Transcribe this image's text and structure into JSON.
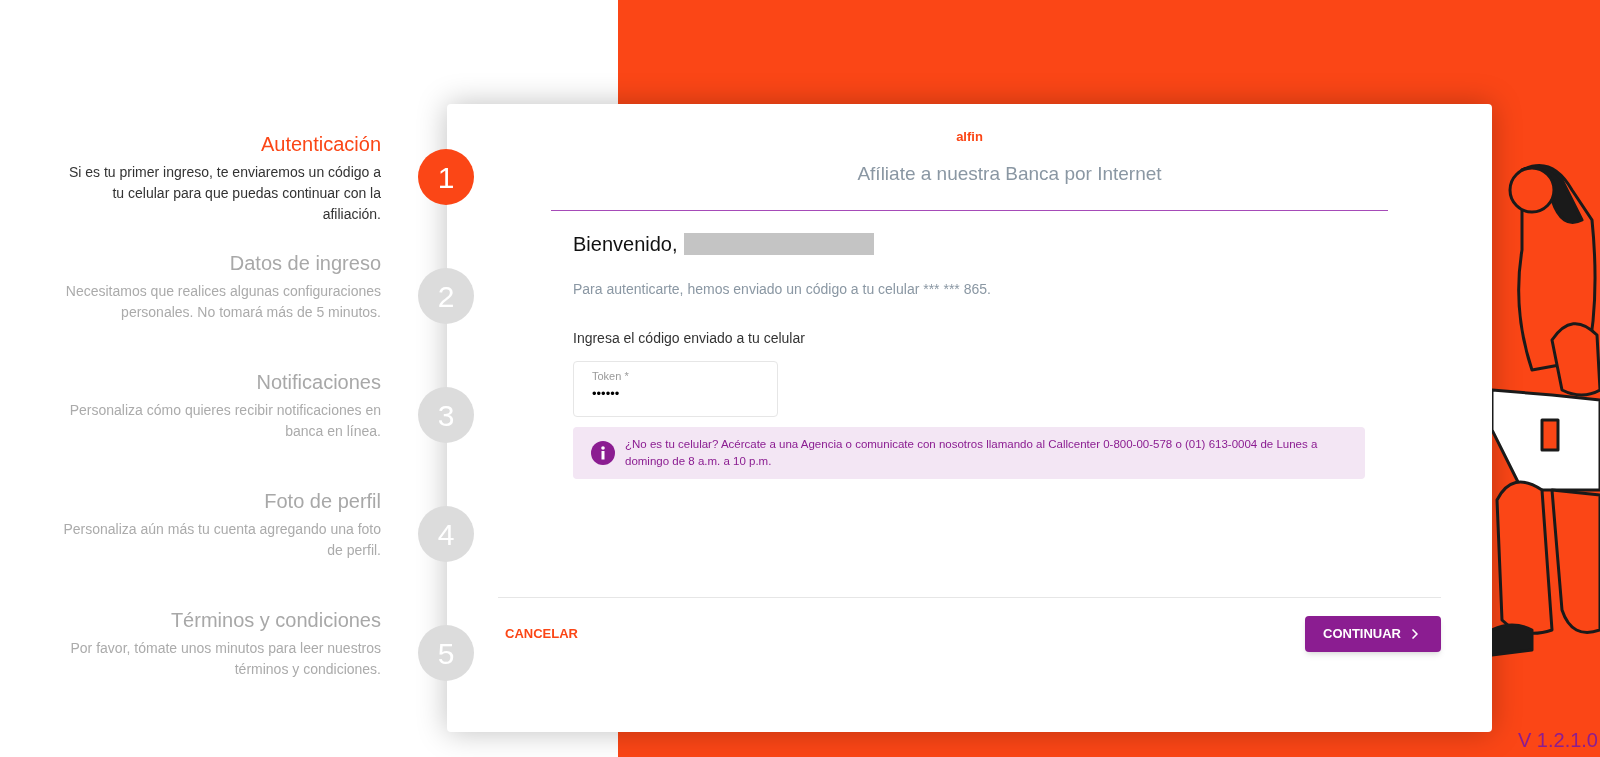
{
  "steps": [
    {
      "number": "1",
      "title": "Autenticación",
      "description": "Si es tu primer ingreso, te enviaremos un código a tu celular para que puedas continuar con la afiliación.",
      "selected": true
    },
    {
      "number": "2",
      "title": "Datos de ingreso",
      "description": "Necesitamos que realices algunas configuraciones personales. No tomará más de 5 minutos.",
      "selected": false
    },
    {
      "number": "3",
      "title": "Notificaciones",
      "description": "Personaliza cómo quieres recibir notificaciones en banca en línea.",
      "selected": false
    },
    {
      "number": "4",
      "title": "Foto de perfil",
      "description": "Personaliza aún más tu cuenta agregando una foto de perfil.",
      "selected": false
    },
    {
      "number": "5",
      "title": "Términos y condiciones",
      "description": "Por favor, tómate unos minutos para leer nuestros términos y condiciones.",
      "selected": false
    }
  ],
  "card": {
    "logo": "alfin",
    "title": "Afíliate a nuestra Banca por Internet",
    "greeting": "Bienvenido,",
    "message": "Para autenticarte, hemos enviado un código a tu celular *** *** 865.",
    "code_label": "Ingresa el código enviado a tu celular",
    "token_field": {
      "label": "Token *",
      "value": "••••••"
    },
    "info": "¿No es tu celular? Acércate a una Agencia o comunicate con nosotros llamando al Callcenter 0-800-00-578 o (01) 613-0004 de Lunes a domingo de 8 a.m. a 10 p.m.",
    "cancel": "CANCELAR",
    "continue": "CONTINUAR"
  },
  "version": "V 1.2.1.0"
}
